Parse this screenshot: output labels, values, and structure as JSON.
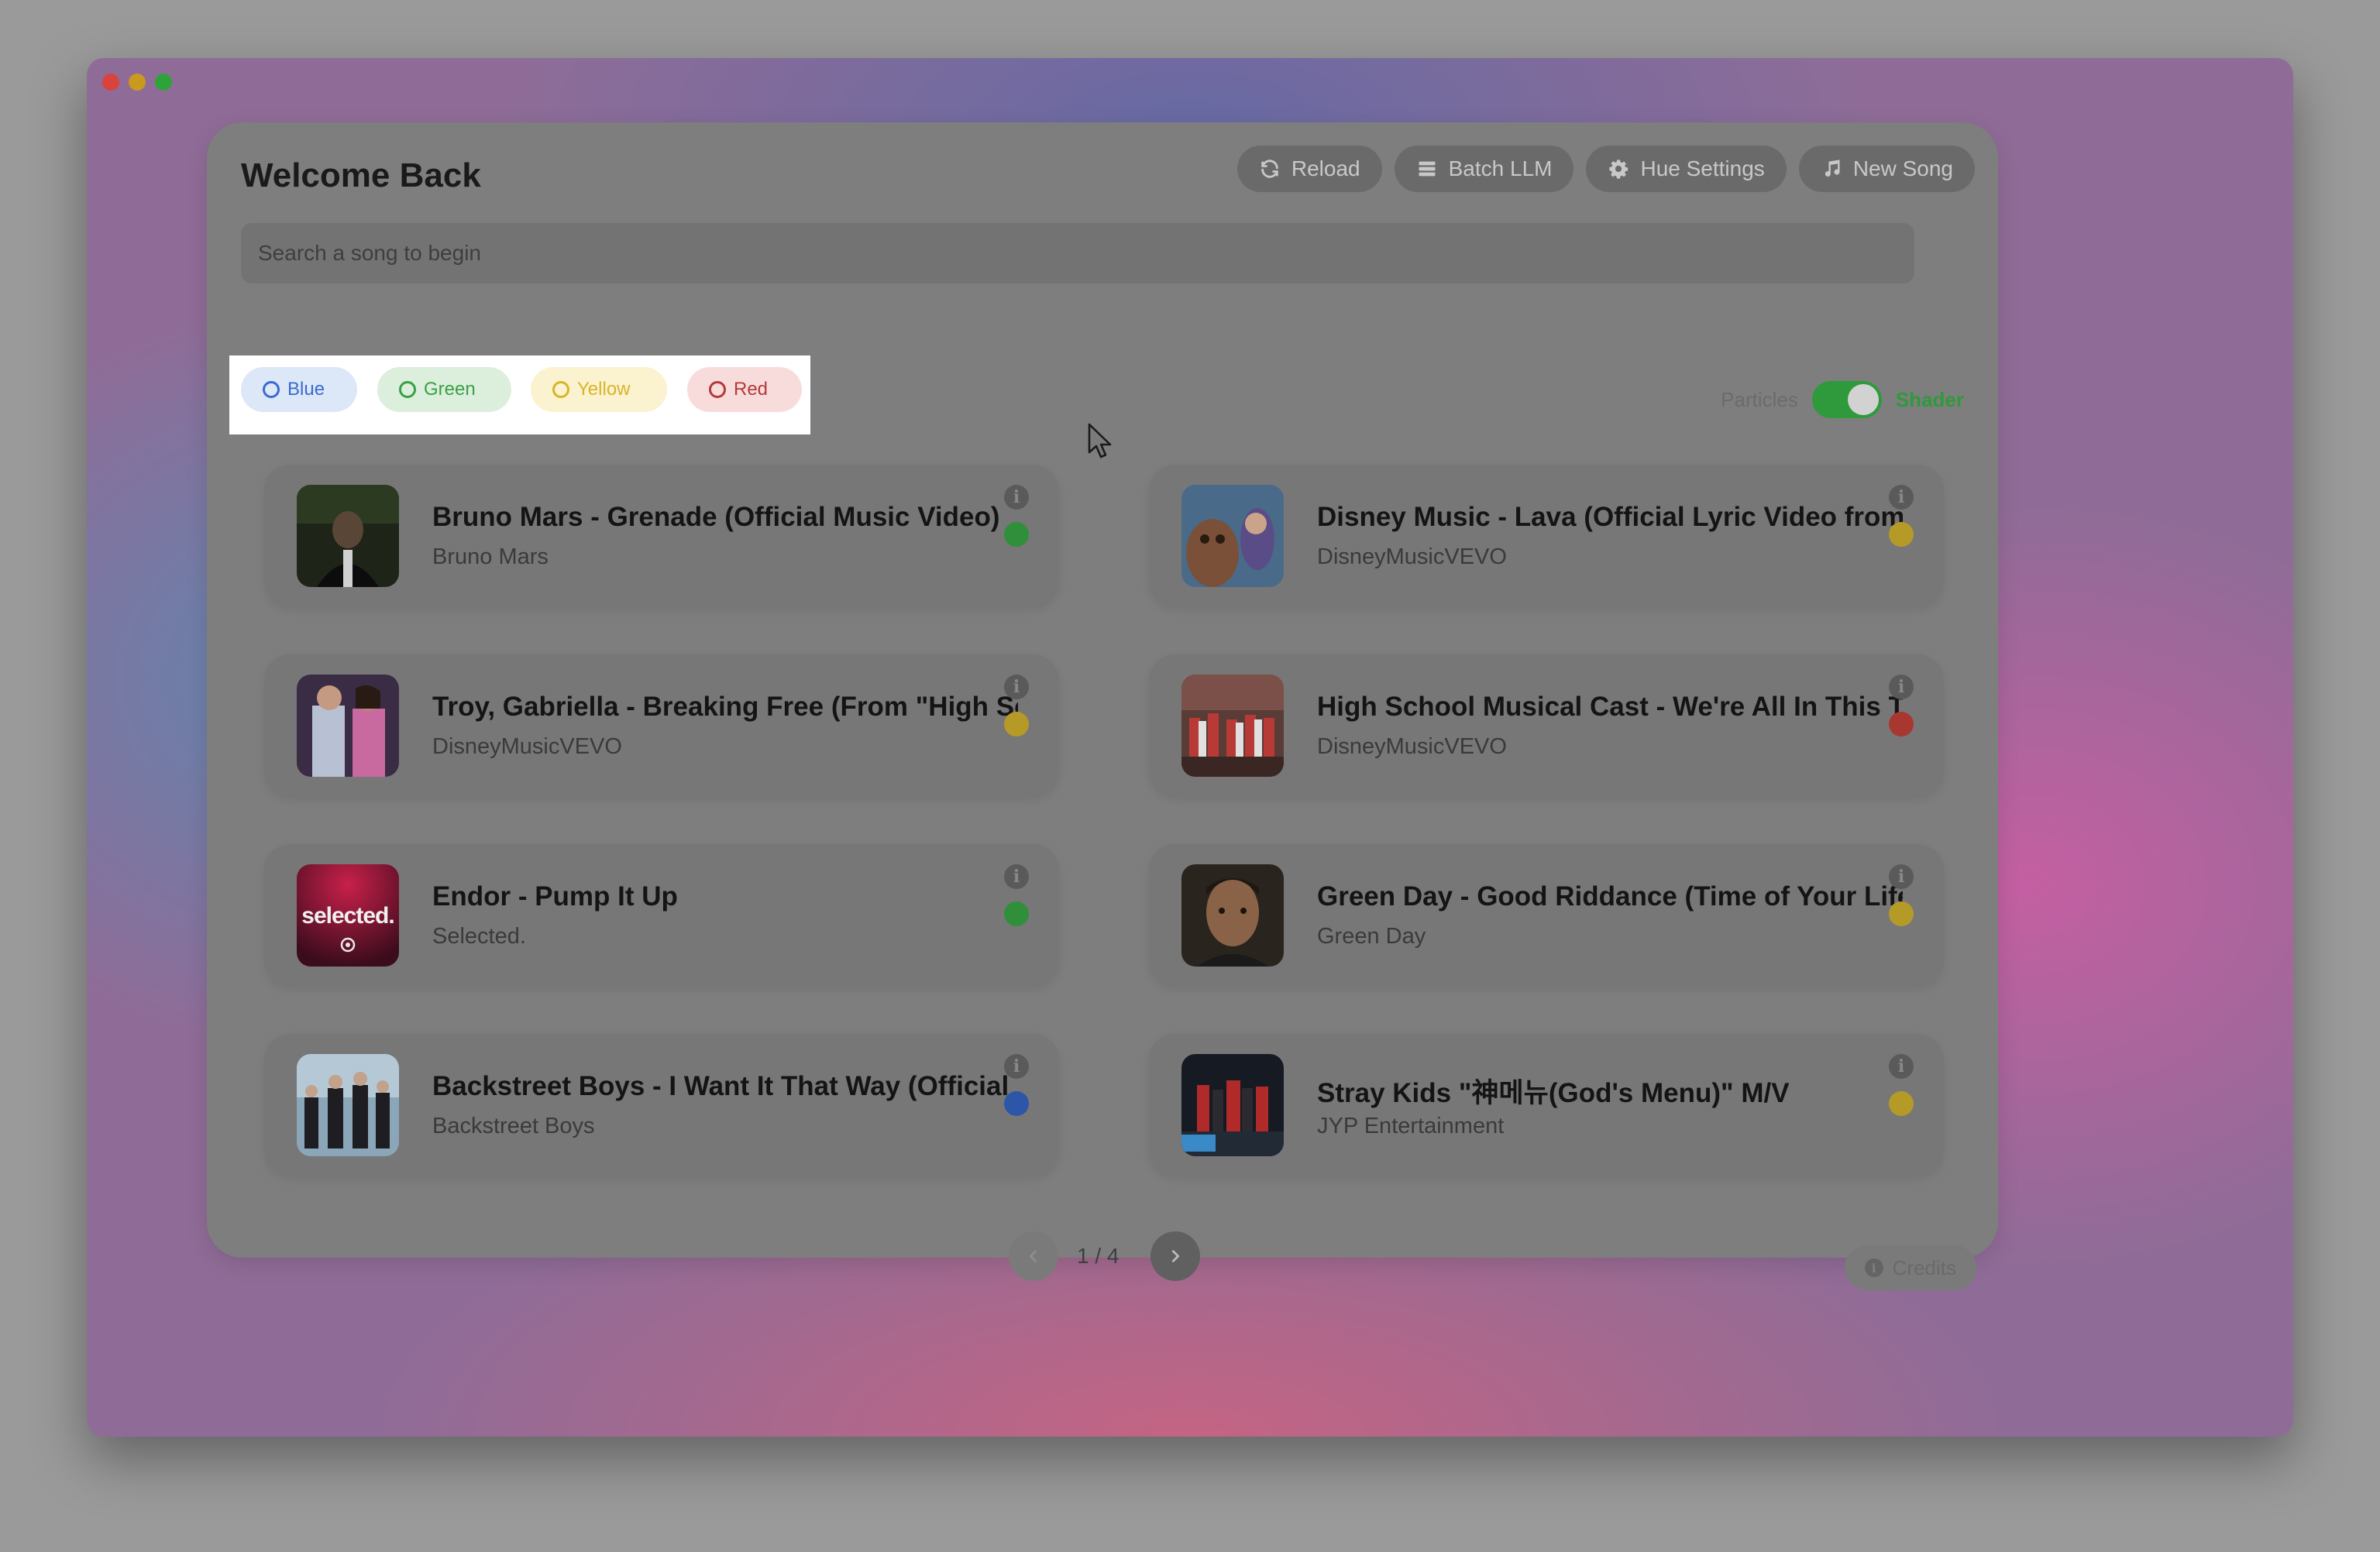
{
  "app": {
    "title": "Welcome Back"
  },
  "toolbar": {
    "reload_label": "Reload",
    "batch_label": "Batch LLM",
    "hue_label": "Hue Settings",
    "new_song_label": "New Song"
  },
  "search": {
    "placeholder": "Search a song to begin",
    "value": ""
  },
  "filters": [
    {
      "label": "Blue",
      "color": "#3a6bd0"
    },
    {
      "label": "Green",
      "color": "#3aa047"
    },
    {
      "label": "Yellow",
      "color": "#d7b52a"
    },
    {
      "label": "Red",
      "color": "#b43a3a"
    }
  ],
  "mode": {
    "left_label": "Particles",
    "right_label": "Shader",
    "selected": "Shader"
  },
  "songs": [
    {
      "title": "Bruno Mars - Grenade (Official Music Video)",
      "artist": "Bruno Mars",
      "hue": "green"
    },
    {
      "title": "Disney Music - Lava (Official Lyric Video from Lava)",
      "artist": "DisneyMusicVEVO",
      "hue": "yellow"
    },
    {
      "title": "Troy, Gabriella - Breaking Free (From \"High School Musical\")",
      "artist": "DisneyMusicVEVO",
      "hue": "yellow"
    },
    {
      "title": "High School Musical Cast - We're All In This Together",
      "artist": "DisneyMusicVEVO",
      "hue": "red"
    },
    {
      "title": "Endor - Pump It Up",
      "artist": "Selected.",
      "hue": "green"
    },
    {
      "title": "Green Day - Good Riddance (Time of Your Life)",
      "artist": "Green Day",
      "hue": "yellow"
    },
    {
      "title": "Backstreet Boys - I Want It That Way (Official Music Video)",
      "artist": "Backstreet Boys",
      "hue": "blue"
    },
    {
      "title": "Stray Kids \"神메뉴(God's Menu)\" M/V",
      "artist": "JYP Entertainment",
      "hue": "yellow"
    }
  ],
  "thumbnails": {
    "endor_text": "selected."
  },
  "pagination": {
    "current": 1,
    "total": 4,
    "label": "1 / 4"
  },
  "footer": {
    "credits_label": "Credits"
  },
  "icons": {
    "reload": "refresh-icon",
    "batch": "stack-icon",
    "hue": "gear-icon",
    "new_song": "music-note-icon",
    "info": "info-icon",
    "credits": "info-icon",
    "prev": "chevron-left-icon",
    "next": "chevron-right-icon"
  },
  "colors": {
    "accent_green": "#2e9a3b",
    "hue_green": "#2f8f3a",
    "hue_yellow": "#b69a28",
    "hue_red": "#a8372f",
    "hue_blue": "#2d55a8"
  }
}
